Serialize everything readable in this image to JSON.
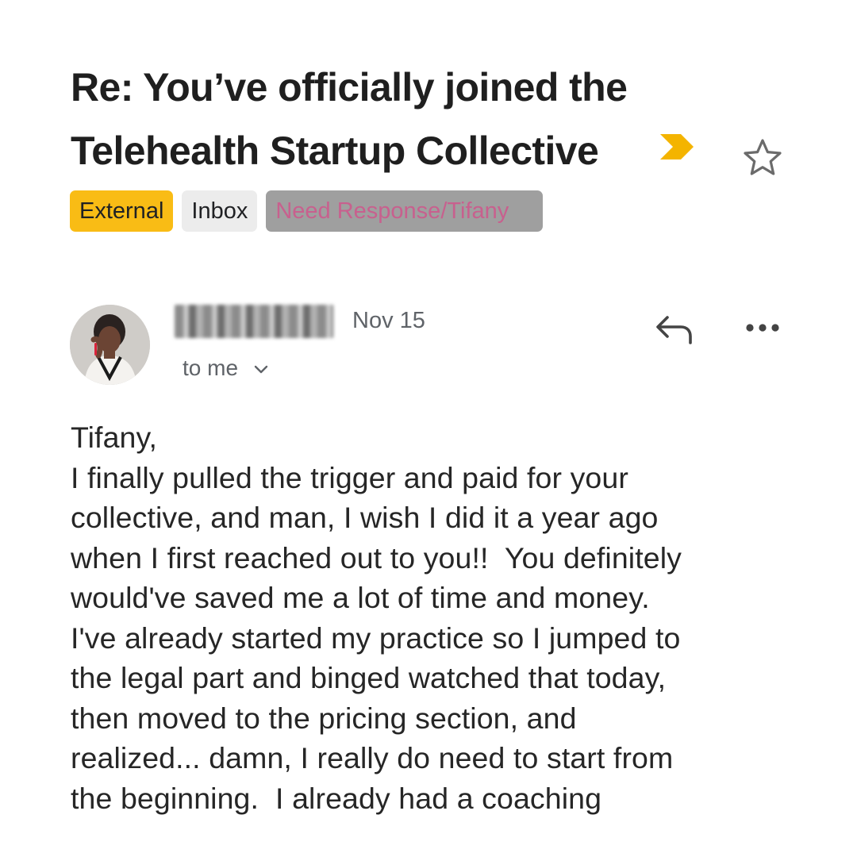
{
  "email": {
    "subject_lines": [
      "Re: You’ve officially joined the",
      "Telehealth Startup Collective"
    ],
    "labels": [
      {
        "text": "External",
        "color": "#f9bc15"
      },
      {
        "text": "Inbox",
        "color": "#ececec"
      },
      {
        "text": "Need Response/Tifany",
        "color": "#9f9f9f"
      }
    ],
    "icons": {
      "importance": "importance-marker-icon",
      "star": "star-outline-icon",
      "reply": "reply-arrow-icon",
      "more": "more-horizontal-icon",
      "recipient_toggle": "chevron-down-icon"
    },
    "message": {
      "date": "Nov 15",
      "recipient": "to me",
      "body_lines": [
        "Tifany,",
        "I finally pulled the trigger and paid for your",
        "collective, and man, I wish I did it a year ago",
        "when I first reached out to you!!  You definitely",
        "would've saved me a lot of time and money.",
        "I've already started my practice so I jumped to",
        "the legal part and binged watched that today,",
        "then moved to the pricing section, and",
        "realized... damn, I really do need to start from",
        "the beginning.  I already had a coaching"
      ]
    }
  }
}
